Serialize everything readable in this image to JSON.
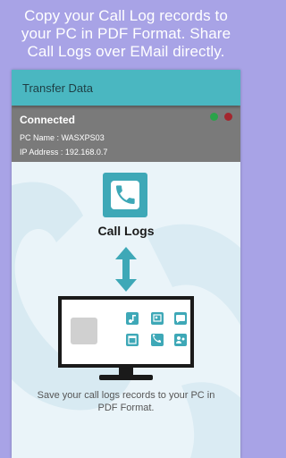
{
  "promo": {
    "line1": "Copy your Call Log records to",
    "line2": "your PC in PDF Format. Share",
    "line3": "Call Logs over EMail directly."
  },
  "appbar": {
    "title": "Transfer Data"
  },
  "status": {
    "connected": "Connected",
    "pc_name": "PC Name : WASXPS03",
    "ip_address": "IP Address : 192.168.0.7",
    "indicator_colors": {
      "green": "#2aa34a",
      "red": "#a3262e"
    }
  },
  "content": {
    "icon_label": "Call Logs",
    "caption_line1": "Save your call logs records to your PC in",
    "caption_line2": "PDF Format."
  },
  "colors": {
    "background": "#a8a3e6",
    "accent": "#4ab7c1",
    "tile": "#3ea8b7",
    "status_bar": "#7a7a7a"
  },
  "icons": {
    "phone": "phone-icon",
    "arrow": "double-arrow-icon",
    "monitor": "monitor-icon",
    "apps": [
      "music-icon",
      "contact-card-icon",
      "message-icon",
      "calendar-icon",
      "phone-icon",
      "contacts-icon"
    ]
  }
}
